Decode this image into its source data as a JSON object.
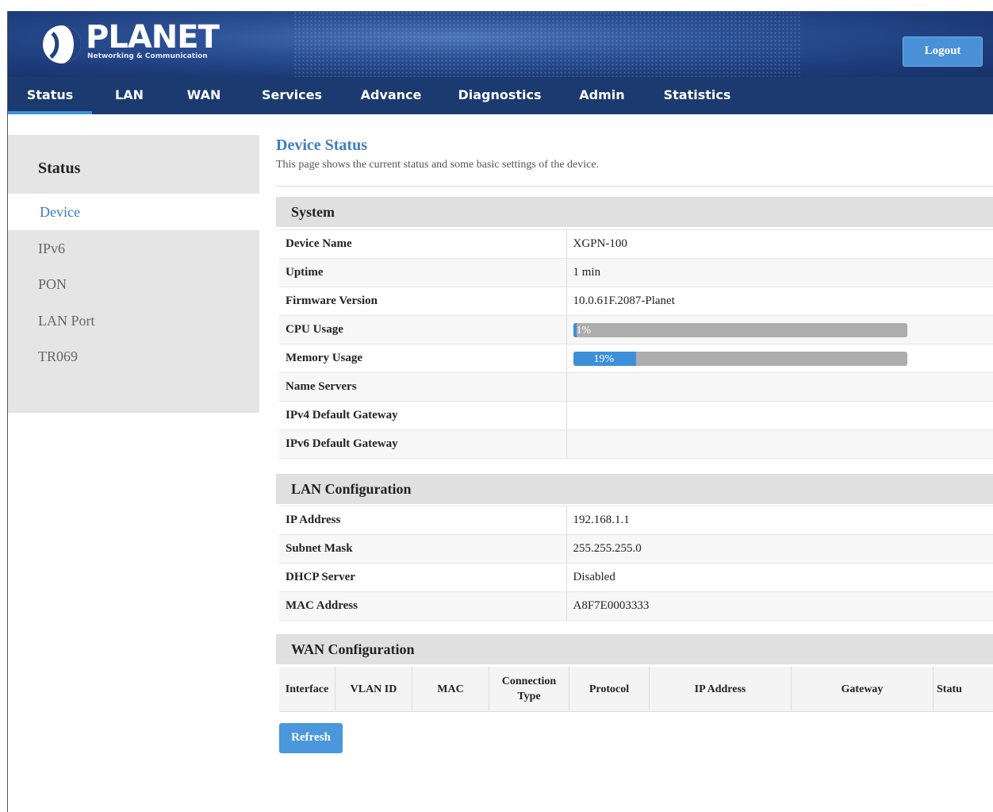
{
  "brand": {
    "name": "PLANET",
    "tagline": "Networking & Communication"
  },
  "header": {
    "logout_label": "Logout"
  },
  "nav": {
    "items": [
      {
        "label": "Status"
      },
      {
        "label": "LAN"
      },
      {
        "label": "WAN"
      },
      {
        "label": "Services"
      },
      {
        "label": "Advance"
      },
      {
        "label": "Diagnostics"
      },
      {
        "label": "Admin"
      },
      {
        "label": "Statistics"
      }
    ],
    "active": "Status"
  },
  "sidebar": {
    "title": "Status",
    "items": [
      {
        "label": "Device"
      },
      {
        "label": "IPv6"
      },
      {
        "label": "PON"
      },
      {
        "label": "LAN Port"
      },
      {
        "label": "TR069"
      }
    ],
    "active": "Device"
  },
  "page": {
    "title": "Device Status",
    "description": "This page shows the current status and some basic settings of the device."
  },
  "system": {
    "title": "System",
    "device_name": {
      "label": "Device Name",
      "value": "XGPN-100"
    },
    "uptime": {
      "label": "Uptime",
      "value": "1 min"
    },
    "firmware": {
      "label": "Firmware Version",
      "value": "10.0.61F.2087-Planet"
    },
    "cpu": {
      "label": "CPU Usage",
      "value_text": "1%",
      "percent": 1
    },
    "memory": {
      "label": "Memory Usage",
      "value_text": "19%",
      "percent": 19
    },
    "name_servers": {
      "label": "Name Servers",
      "value": ""
    },
    "ipv4_gateway": {
      "label": "IPv4 Default Gateway",
      "value": ""
    },
    "ipv6_gateway": {
      "label": "IPv6 Default Gateway",
      "value": ""
    }
  },
  "lan": {
    "title": "LAN Configuration",
    "ip": {
      "label": "IP Address",
      "value": "192.168.1.1"
    },
    "mask": {
      "label": "Subnet Mask",
      "value": "255.255.255.0"
    },
    "dhcp": {
      "label": "DHCP Server",
      "value": "Disabled"
    },
    "mac": {
      "label": "MAC Address",
      "value": "A8F7E0003333"
    }
  },
  "wan": {
    "title": "WAN Configuration",
    "columns": [
      "Interface",
      "VLAN ID",
      "MAC",
      "Connection Type",
      "Protocol",
      "IP Address",
      "Gateway",
      "Statu"
    ]
  },
  "actions": {
    "refresh_label": "Refresh"
  },
  "colors": {
    "nav_bg": "#1b3a70",
    "accent": "#3d7fc0",
    "button": "#4a97db",
    "progress_fill": "#3e8fd9",
    "progress_track": "#adadad"
  }
}
